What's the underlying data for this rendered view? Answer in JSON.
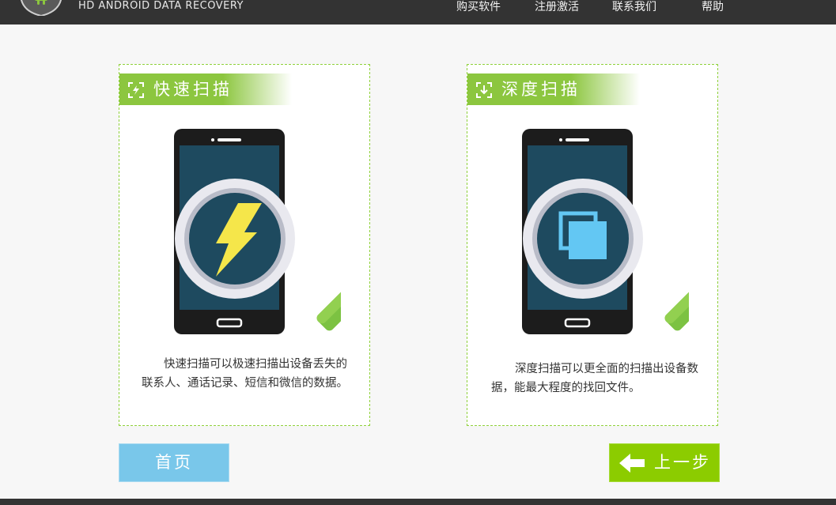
{
  "header": {
    "app_title": "HD ANDROID DATA RECOVERY",
    "nav": [
      "购买软件",
      "注册激活",
      "联系我们",
      "帮助"
    ]
  },
  "cards": [
    {
      "title": "快速扫描",
      "description": "快速扫描可以极速扫描出设备丢失的联系人、通话记录、短信和微信的数据。",
      "icon": "lightning-icon"
    },
    {
      "title": "深度扫描",
      "description": "深度扫描可以更全面的扫描出设备数据，能最大程度的找回文件。",
      "icon": "layers-icon"
    }
  ],
  "buttons": {
    "home": "首页",
    "back": "上一步"
  },
  "colors": {
    "accent_green": "#8cc63f",
    "button_green": "#8ccc00",
    "button_blue": "#79c7ea",
    "topbar": "#333333",
    "phone_screen": "#1e4a5f"
  }
}
